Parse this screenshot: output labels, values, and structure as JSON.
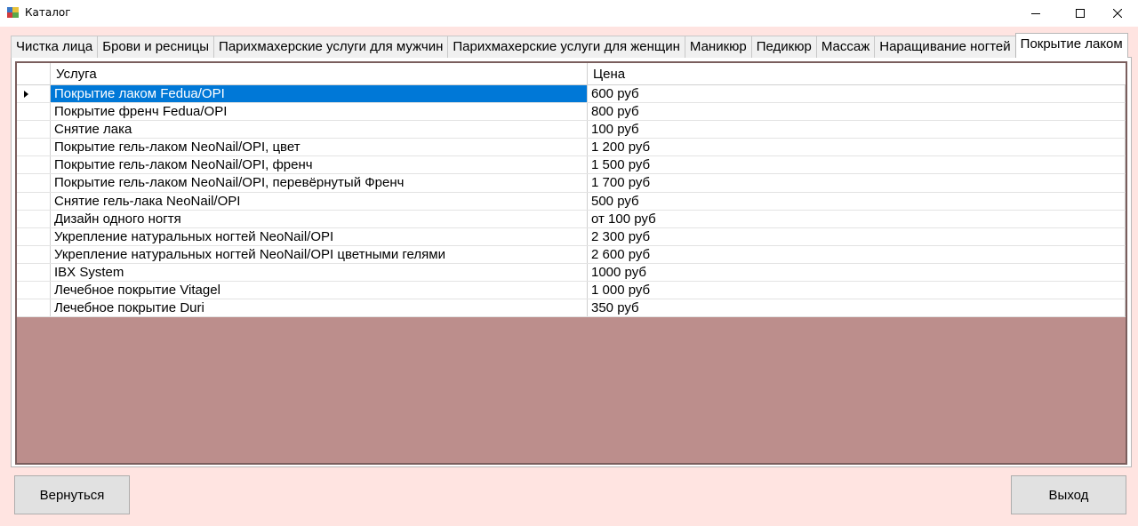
{
  "window": {
    "title": "Каталог"
  },
  "tabs": [
    "Чистка лица",
    "Брови и ресницы",
    "Парихмахерские услуги для мужчин",
    "Парихмахерские услуги для женщин",
    "Маникюр",
    "Педикюр",
    "Массаж",
    "Наращивание ногтей",
    "Покрытие лаком"
  ],
  "active_tab": "Покрытие лаком",
  "grid": {
    "columns": [
      "Услуга",
      "Цена"
    ],
    "selected_row": 0,
    "rows": [
      {
        "service": "Покрытие лаком Fedua/OPI",
        "price": "600 руб"
      },
      {
        "service": "Покрытие френч Fedua/OPI",
        "price": "800 руб"
      },
      {
        "service": "Снятие лака",
        "price": "100 руб"
      },
      {
        "service": "Покрытие гель-лаком NeoNail/OPI, цвет",
        "price": "1 200 руб"
      },
      {
        "service": "Покрытие гель-лаком NeoNail/OPI, френч",
        "price": "1 500 руб"
      },
      {
        "service": "Покрытие гель-лаком NeoNail/OPI, перевёрнутый Френч",
        "price": "1 700 руб"
      },
      {
        "service": "Снятие гель-лака NeoNail/OPI",
        "price": "500 руб"
      },
      {
        "service": "Дизайн одного ногтя",
        "price": "от 100 руб"
      },
      {
        "service": "Укрепление натуральных ногтей NeoNail/OPI",
        "price": "2 300 руб"
      },
      {
        "service": "Укрепление натуральных ногтей NeoNail/OPI цветными гелями",
        "price": "2 600 руб"
      },
      {
        "service": "IBX System",
        "price": "1000 руб"
      },
      {
        "service": "Лечебное покрытие Vitagel",
        "price": "1 000 руб"
      },
      {
        "service": "Лечебное покрытие Duri",
        "price": "350 руб"
      }
    ]
  },
  "buttons": {
    "back": "Вернуться",
    "exit": "Выход"
  },
  "colors": {
    "form_background": "#ffe4e1",
    "grid_background": "#bc8e8c",
    "selection": "#0078d7"
  }
}
